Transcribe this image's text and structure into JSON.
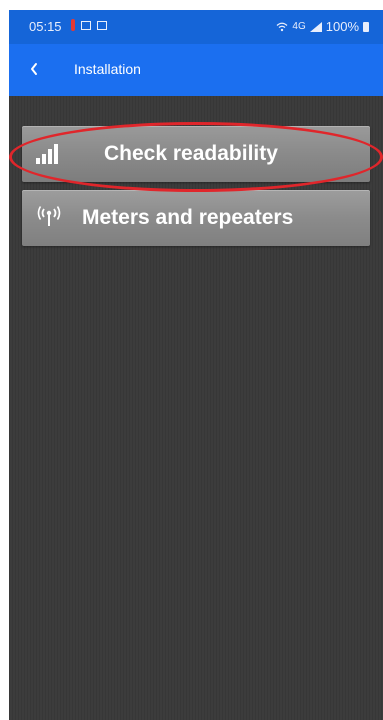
{
  "status_bar": {
    "time": "05:15",
    "network": "4G",
    "battery": "100%"
  },
  "app_bar": {
    "back_icon": "chevron-left-icon",
    "title": "Installation"
  },
  "menu": {
    "items": [
      {
        "label": "Check readability",
        "icon": "signal-bars-icon"
      },
      {
        "label": "Meters and repeaters",
        "icon": "antenna-icon"
      }
    ]
  },
  "colors": {
    "status_bar": "#1565d8",
    "app_bar": "#1b6ff0",
    "background": "#3c3c3c",
    "button": "#8a8a8a",
    "highlight": "#e0262b"
  }
}
